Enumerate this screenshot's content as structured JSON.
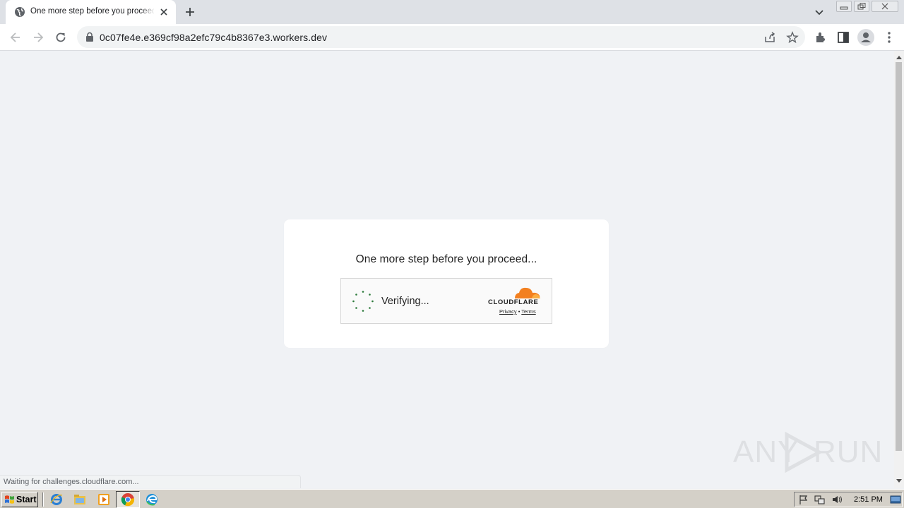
{
  "browser": {
    "tab": {
      "title": "One more step before you proceed...",
      "favicon": "globe-icon"
    },
    "url": "0c07fe4e.e369cf98a2efc79c4b8367e3.workers.dev",
    "status_text": "Waiting for challenges.cloudflare.com..."
  },
  "page": {
    "heading": "One more step before you proceed...",
    "widget": {
      "status": "Verifying...",
      "brand": "CLOUDFLARE",
      "privacy_label": "Privacy",
      "separator": "•",
      "terms_label": "Terms",
      "spinner_color": "#2c7a3b",
      "brand_color": "#f38020"
    }
  },
  "watermark": {
    "left": "ANY",
    "right": "RUN"
  },
  "taskbar": {
    "start_label": "Start",
    "clock": "2:51 PM"
  }
}
